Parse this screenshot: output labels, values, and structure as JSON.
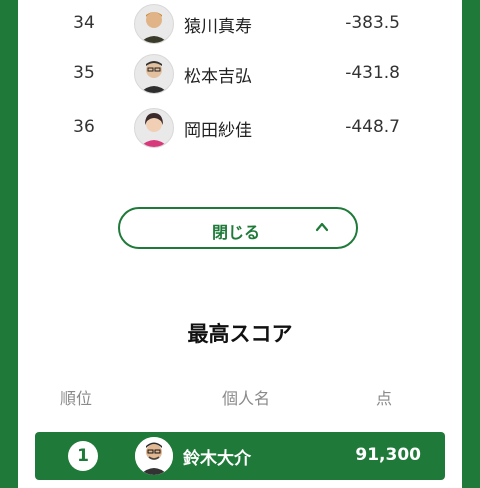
{
  "ranking": {
    "rows": [
      {
        "rank": "34",
        "name": "猿川真寿",
        "score": "-383.5"
      },
      {
        "rank": "35",
        "name": "松本吉弘",
        "score": "-431.8"
      },
      {
        "rank": "36",
        "name": "岡田紗佳",
        "score": "-448.7"
      }
    ]
  },
  "close_button": {
    "label": "閉じる",
    "icon": "chevron-up-icon"
  },
  "high_score": {
    "title": "最高スコア",
    "headers": {
      "rank": "順位",
      "name": "個人名",
      "score": "点"
    },
    "top": {
      "rank": "1",
      "name": "鈴木大介",
      "score": "91,300"
    }
  },
  "colors": {
    "brand_green": "#1f7a3a"
  }
}
